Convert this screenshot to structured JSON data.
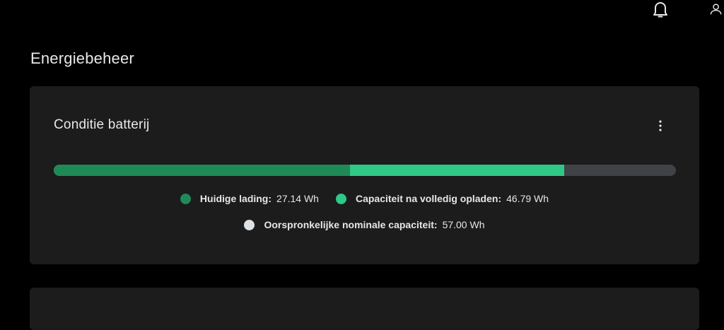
{
  "header": {
    "bell_icon": "bell-icon",
    "user_icon": "user-icon"
  },
  "page": {
    "title": "Energiebeheer"
  },
  "battery_card": {
    "title": "Conditie batterij",
    "more_icon": "more-vertical-icon",
    "bar": {
      "nominal_wh": 57.0,
      "full_charge_wh": 46.79,
      "current_wh": 27.14
    },
    "legend": {
      "current": {
        "label": "Huidige lading:",
        "value": "27.14 Wh",
        "color": "#1f8a58"
      },
      "full": {
        "label": "Capaciteit na volledig opladen:",
        "value": "46.79 Wh",
        "color": "#2fc887"
      },
      "nominal": {
        "label": "Oorspronkelijke nominale capaciteit:",
        "value": "57.00 Wh",
        "color": "#dde1e6"
      }
    },
    "track_color": "#3f4247"
  }
}
